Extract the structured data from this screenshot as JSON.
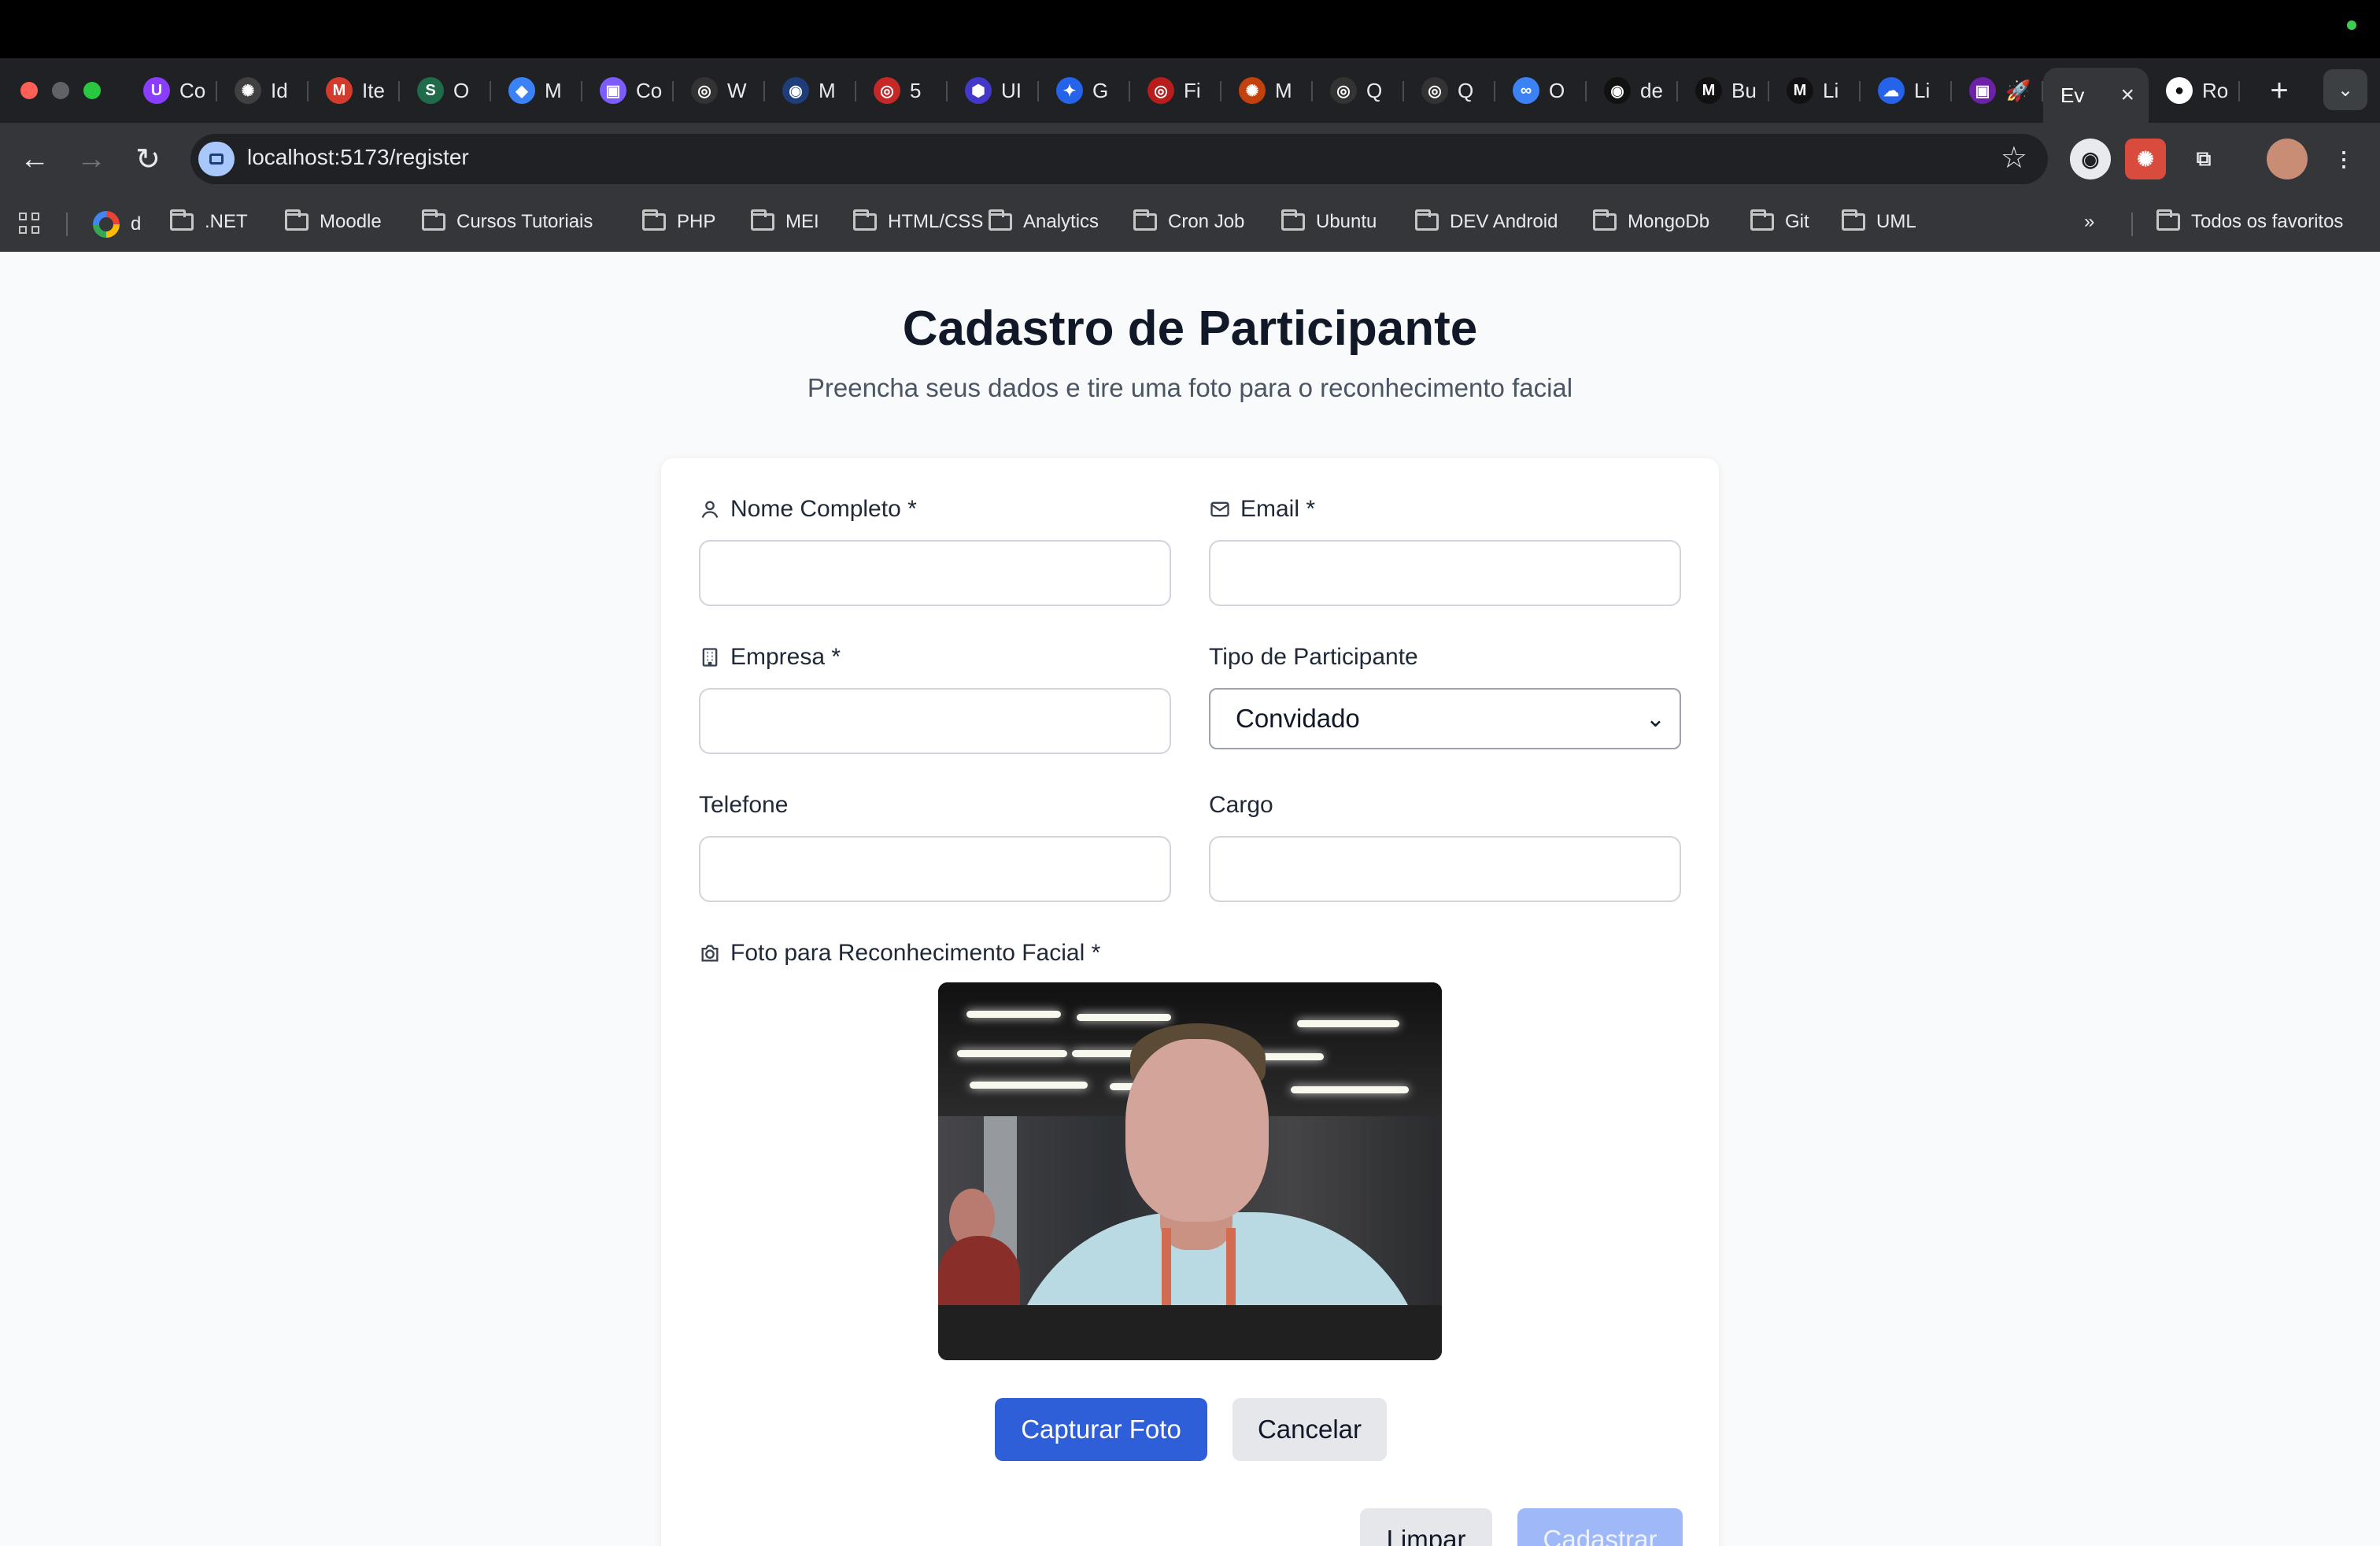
{
  "browser": {
    "tabs": [
      {
        "label": "Co",
        "icon": "U",
        "color": "#8b3dff"
      },
      {
        "label": "Id",
        "icon": "✺",
        "color": "#404040"
      },
      {
        "label": "Ite",
        "icon": "M",
        "color": "#d33b2c"
      },
      {
        "label": "O",
        "icon": "S",
        "color": "#1f6b4a"
      },
      {
        "label": "M",
        "icon": "◆",
        "color": "#3b82f6"
      },
      {
        "label": "Co",
        "icon": "▣",
        "color": "#7c5cff"
      },
      {
        "label": "W",
        "icon": "◎",
        "color": "#333333"
      },
      {
        "label": "M",
        "icon": "◉",
        "color": "#1f3d7a"
      },
      {
        "label": "5",
        "icon": "◎",
        "color": "#c62828"
      },
      {
        "label": "UI",
        "icon": "⬢",
        "color": "#4338ca"
      },
      {
        "label": "G",
        "icon": "✦",
        "color": "#2563eb"
      },
      {
        "label": "Fi",
        "icon": "◎",
        "color": "#b91c1c"
      },
      {
        "label": "M",
        "icon": "✺",
        "color": "#c2410c"
      },
      {
        "label": "Q",
        "icon": "◎",
        "color": "#333333"
      },
      {
        "label": "Q",
        "icon": "◎",
        "color": "#333333"
      },
      {
        "label": "O",
        "icon": "∞",
        "color": "#3b82f6"
      },
      {
        "label": "de",
        "icon": "◉",
        "color": "#111111"
      },
      {
        "label": "Bu",
        "icon": "M",
        "color": "#111111"
      },
      {
        "label": "Li",
        "icon": "M",
        "color": "#111111"
      },
      {
        "label": "Li",
        "icon": "☁",
        "color": "#2563eb"
      },
      {
        "label": "🚀",
        "icon": "▣",
        "color": "#6b21a8"
      }
    ],
    "active_tab": "Ev",
    "github_tab": "Ro",
    "url": "localhost:5173/register",
    "bookmarks": [
      "d",
      ".NET",
      "Moodle",
      "Cursos Tutoriais",
      "PHP",
      "MEI",
      "HTML/CSS",
      "Analytics",
      "Cron Job",
      "Ubuntu",
      "DEV Android",
      "MongoDb",
      "Git",
      "UML"
    ],
    "more_bookmarks": "»",
    "all_bookmarks": "Todos os favoritos"
  },
  "page": {
    "title": "Cadastro de Participante",
    "subtitle": "Preencha seus dados e tire uma foto para o reconhecimento facial"
  },
  "form": {
    "name_label": "Nome Completo *",
    "email_label": "Email *",
    "company_label": "Empresa *",
    "participant_type_label": "Tipo de Participante",
    "participant_type_value": "Convidado",
    "phone_label": "Telefone",
    "role_label": "Cargo",
    "photo_label": "Foto para Reconhecimento Facial *",
    "capture_button": "Capturar Foto",
    "cancel_button": "Cancelar",
    "clear_button": "Limpar",
    "submit_button": "Cadastrar"
  },
  "icons": {
    "user": "user-icon",
    "mail": "mail-icon",
    "building": "building-icon",
    "camera": "camera-icon"
  }
}
